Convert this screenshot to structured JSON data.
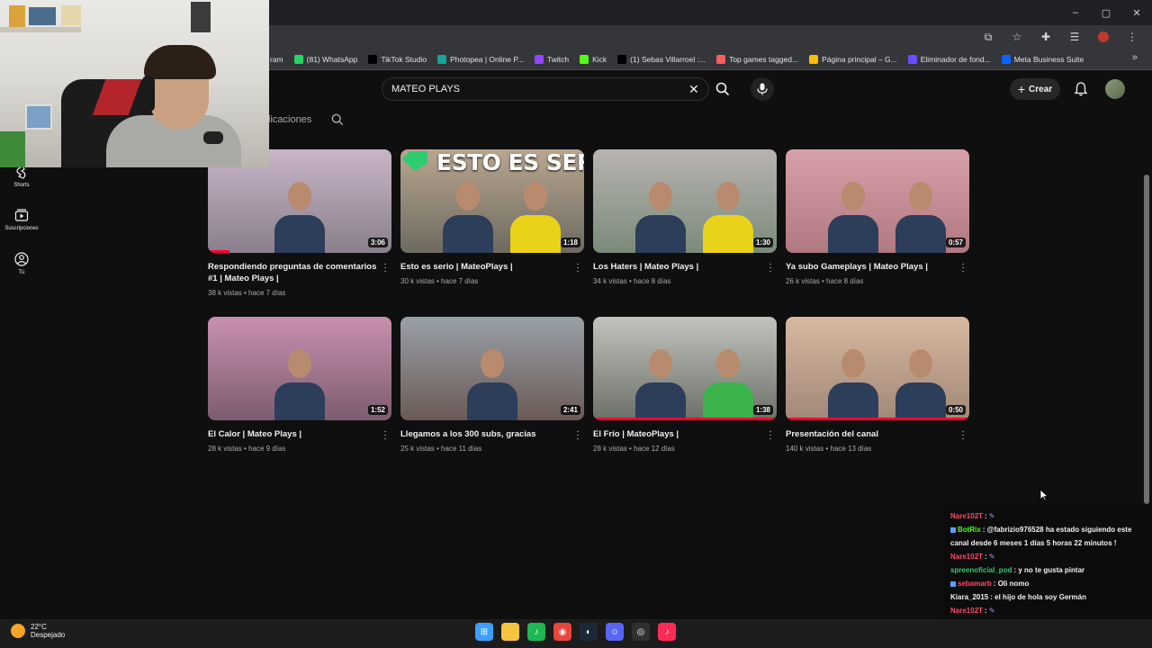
{
  "window": {
    "minimize": "–",
    "maximize": "▢",
    "close": "✕"
  },
  "bookmarks": [
    {
      "label": "ram",
      "color": "#c13584"
    },
    {
      "label": "(81) WhatsApp",
      "color": "#25d366"
    },
    {
      "label": "TikTok Studio",
      "color": "#000000"
    },
    {
      "label": "Photopea | Online P...",
      "color": "#18a497"
    },
    {
      "label": "Twitch",
      "color": "#9146ff"
    },
    {
      "label": "Kick",
      "color": "#53fc18"
    },
    {
      "label": "(1) Sebas Villarroel :...",
      "color": "#000000"
    },
    {
      "label": "Top games tagged...",
      "color": "#fa5c5c"
    },
    {
      "label": "Página principal – G...",
      "color": "#fbbc04"
    },
    {
      "label": "Eliminador de fond...",
      "color": "#6a4cff"
    },
    {
      "label": "Meta Business Suite",
      "color": "#0866ff"
    }
  ],
  "bookmarks_more": "»",
  "search": {
    "query": "MATEO PLAYS",
    "clear": "✕"
  },
  "header": {
    "create_label": "Crear",
    "create_plus": "+"
  },
  "channel_tabs": {
    "partial_tab": "licaciones"
  },
  "sidebar": [
    {
      "label": "Shorts",
      "icon": "shorts-icon"
    },
    {
      "label": "Suscripciones",
      "icon": "subscriptions-icon"
    },
    {
      "label": "Tú",
      "icon": "you-icon"
    }
  ],
  "videos": [
    {
      "title": "Respondiendo preguntas de comentarios #1 | Mateo Plays |",
      "meta": "38 k vistas • hace 7 días",
      "duration": "3:06",
      "progress": 0.12,
      "bg": [
        "#c8b5c8",
        "#8a7f8c"
      ],
      "overlay": ""
    },
    {
      "title": "Esto es serio | MateoPlays |",
      "meta": "30 k vistas • hace 7 días",
      "duration": "1:18",
      "progress": 0,
      "bg": [
        "#b9a690",
        "#6d6a60"
      ],
      "overlay": "ESTO ES SERIO"
    },
    {
      "title": "Los Haters | Mateo Plays |",
      "meta": "34 k vistas • hace 8 días",
      "duration": "1:30",
      "progress": 0,
      "bg": [
        "#b8b4b0",
        "#7a8a7a"
      ],
      "overlay": ""
    },
    {
      "title": "Ya subo Gameplays | Mateo Plays |",
      "meta": "26 k vistas • hace 8 días",
      "duration": "0:57",
      "progress": 0,
      "bg": [
        "#d8a0a8",
        "#b07880"
      ],
      "overlay": ""
    },
    {
      "title": "El Calor | Mateo Plays |",
      "meta": "28 k vistas • hace 9 días",
      "duration": "1:52",
      "progress": 0,
      "bg": [
        "#c890b0",
        "#7c5c70"
      ],
      "overlay": ""
    },
    {
      "title": "Llegamos a los 300 subs, gracias",
      "meta": "25 k vistas • hace 11 días",
      "duration": "2:41",
      "progress": 0,
      "bg": [
        "#9aa0a8",
        "#6a5a56"
      ],
      "overlay": ""
    },
    {
      "title": "El Frío | MateoPlays |",
      "meta": "28 k vistas • hace 12 días",
      "duration": "1:38",
      "progress": 1.0,
      "bg": [
        "#c0c4bc",
        "#6c7068"
      ],
      "overlay": ""
    },
    {
      "title": "Presentación del canal",
      "meta": "140 k vistas • hace 13 días",
      "duration": "0:50",
      "progress": 1.0,
      "bg": [
        "#d8b8a0",
        "#a08878"
      ],
      "overlay": ""
    }
  ],
  "chat": [
    {
      "user": "Nare102T",
      "text": "",
      "color": "#ff4a6a",
      "badge": false
    },
    {
      "user": "BotRix",
      "text": "@fabrizio976528 ha estado siguiendo este canal desde 6 meses 1 días 5 horas 22 minutos !",
      "color": "#53fc18",
      "badge": true
    },
    {
      "user": "Nare102T",
      "text": "",
      "color": "#ff4a6a",
      "badge": false
    },
    {
      "user": "spreenoficial_pod",
      "text": "y no te gusta pintar",
      "color": "#2ecc71",
      "badge": false
    },
    {
      "user": "sebamarb",
      "text": "Oli nomo",
      "color": "#ff4a6a",
      "badge": true
    },
    {
      "user": "Kiara_2015",
      "text": "el hijo de hola soy Germán",
      "color": "#f1f1f1",
      "badge": false
    },
    {
      "user": "Nare102T",
      "text": "",
      "color": "#ff4a6a",
      "badge": false
    },
    {
      "user": "Nare102T",
      "text": "",
      "color": "#ff4a6a",
      "badge": false
    },
    {
      "user": "Nare102T",
      "text": "",
      "color": "#ff4a6a",
      "badge": false
    }
  ],
  "taskbar": {
    "temperature": "22°C",
    "condition": "Despejado",
    "apps": [
      {
        "name": "windows-start-icon",
        "color": "#3aa0ff",
        "glyph": "⊞"
      },
      {
        "name": "file-explorer-icon",
        "color": "#f5c542",
        "glyph": ""
      },
      {
        "name": "spotify-icon",
        "color": "#1db954",
        "glyph": "♪"
      },
      {
        "name": "chrome-icon",
        "color": "#e8453c",
        "glyph": "◉"
      },
      {
        "name": "steam-icon",
        "color": "#1b2838",
        "glyph": "◐"
      },
      {
        "name": "discord-icon",
        "color": "#5865f2",
        "glyph": "☺"
      },
      {
        "name": "obs-icon",
        "color": "#303030",
        "glyph": "◎"
      },
      {
        "name": "tiktok-icon",
        "color": "#fe2c55",
        "glyph": "♪"
      }
    ]
  }
}
